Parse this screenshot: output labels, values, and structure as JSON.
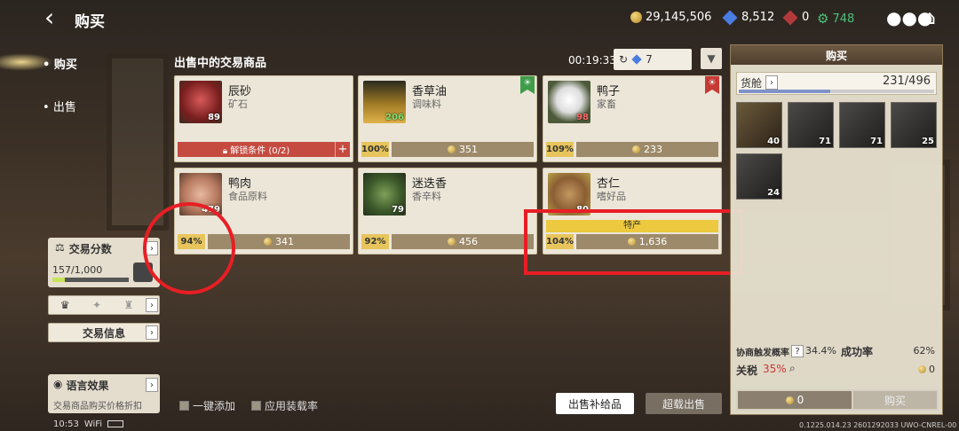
{
  "header": {
    "back_label": "‹",
    "title": "购买",
    "gold": "29,145,506",
    "gems": "8,512",
    "rubies": "0",
    "gear": "748"
  },
  "nav": {
    "buy": "购买",
    "sell": "出售"
  },
  "left": {
    "trade_score_label": "交易分数",
    "trade_score_value": "157/1,000",
    "trade_score_progress": 0.157,
    "trade_info_label": "交易信息",
    "language_label": "语言效果",
    "language_desc": "交易商品购买价格折扣"
  },
  "main": {
    "section_title": "出售中的交易商品",
    "timer": "00:19:33",
    "refresh_count": "7",
    "items": [
      {
        "name": "辰砂",
        "category": "矿石",
        "qty": "89",
        "lock_text": "解锁条件 (0/2)",
        "thumb": "cinnabar"
      },
      {
        "name": "香草油",
        "category": "调味料",
        "qty": "206",
        "pct": "100%",
        "price": "351",
        "flag": "up",
        "thumb": "vanilla-oil"
      },
      {
        "name": "鸭子",
        "category": "家畜",
        "qty": "98",
        "pct": "109%",
        "price": "233",
        "flag": "down",
        "thumb": "duck"
      },
      {
        "name": "鸭肉",
        "category": "食品原料",
        "qty": "479",
        "pct": "94%",
        "price": "341",
        "thumb": "duck-meat"
      },
      {
        "name": "迷迭香",
        "category": "香辛料",
        "qty": "79",
        "pct": "92%",
        "price": "456",
        "thumb": "rosemary"
      },
      {
        "name": "杏仁",
        "category": "嗜好品",
        "qty": "80",
        "pct": "104%",
        "price": "1,636",
        "special": "特产",
        "thumb": "almond"
      }
    ],
    "one_click_label": "一键添加",
    "apply_load_label": "应用装载率",
    "sell_supply_label": "出售补给品",
    "overload_sell_label": "超载出售"
  },
  "right": {
    "title": "购买",
    "cargo_label": "货舱",
    "cargo_value": "231/496",
    "cargo_fill": 0.466,
    "slots": [
      {
        "qty": "40"
      },
      {
        "qty": "71"
      },
      {
        "qty": "71"
      },
      {
        "qty": "25"
      },
      {
        "qty": "24"
      }
    ],
    "merchant_rate_label": "协商触发概率",
    "merchant_rate_help": "?",
    "merchant_rate": "34.4%",
    "success_label": "成功率",
    "success_value": "62%",
    "tax_label": "关税",
    "tax_value": "35%",
    "tax_cost": "0",
    "total": "0",
    "buy_label": "购买"
  },
  "status": {
    "time": "10:53",
    "wifi": "WiFi",
    "version": "0.1225.014.23 2601292033 UWO-CNREL-00"
  },
  "colors": {
    "accent_red": "#e81e25",
    "price_bar": "#9d8a6a",
    "pct_bar": "#e7c55c",
    "special": "#ecc93e",
    "gear": "#4bc078"
  }
}
